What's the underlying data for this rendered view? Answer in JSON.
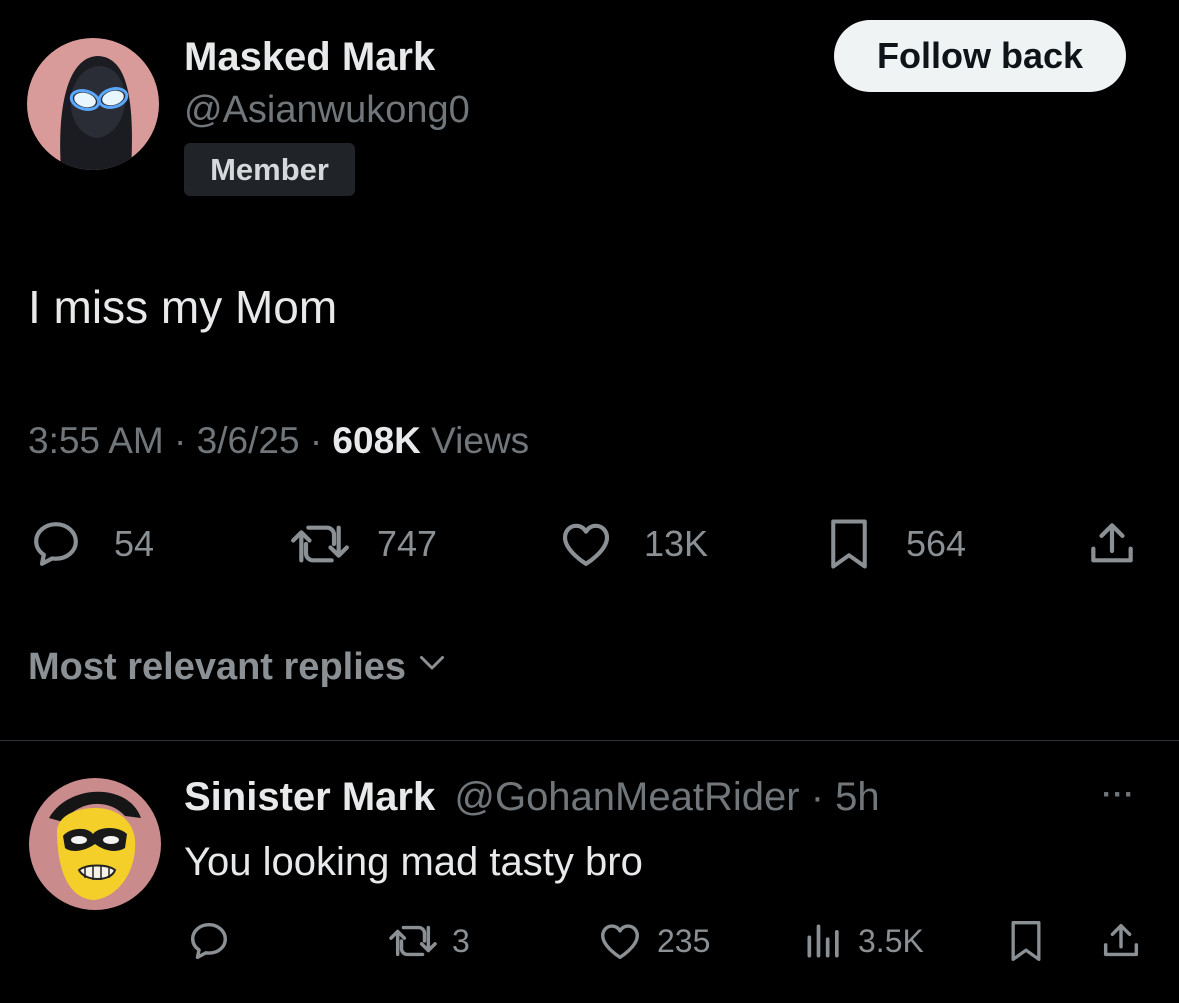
{
  "post": {
    "author_name": "Masked Mark",
    "author_handle": "@Asianwukong0",
    "badge": "Member",
    "follow_button": "Follow back",
    "text": "I miss my Mom",
    "time": "3:55 AM",
    "sep1": "·",
    "date": "3/6/25",
    "sep2": "·",
    "views_count": "608K",
    "views_label": "Views",
    "actions": {
      "replies": "54",
      "reposts": "747",
      "likes": "13K",
      "bookmarks": "564"
    },
    "icons": [
      "reply-icon",
      "repost-icon",
      "like-icon",
      "bookmark-icon",
      "share-icon"
    ]
  },
  "sort": {
    "label": "Most relevant replies",
    "icon": "chevron-down-icon"
  },
  "reply": {
    "author_name": "Sinister Mark",
    "author_handle": "@GohanMeatRider",
    "sep": "·",
    "time": "5h",
    "text": "You looking mad tasty bro",
    "more": "···",
    "actions": {
      "reposts": "3",
      "likes": "235",
      "views": "3.5K"
    },
    "icons": [
      "reply-icon",
      "repost-icon",
      "like-icon",
      "views-icon",
      "bookmark-icon",
      "share-icon"
    ]
  },
  "colors": {
    "background": "#000000",
    "text": "#e7e9ea",
    "muted": "#71767b",
    "button_bg": "#eff3f4",
    "badge_bg": "#202327"
  }
}
